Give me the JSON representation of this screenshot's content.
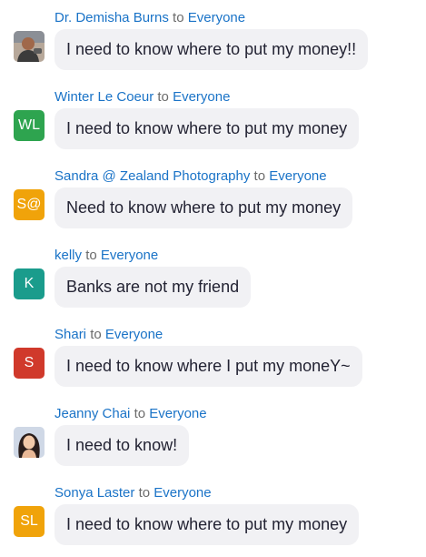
{
  "messages": [
    {
      "sender": "Dr. Demisha Burns",
      "to_word": "to",
      "recipient": "Everyone",
      "text": "I need to know where to put my money!!",
      "avatar_type": "photo",
      "avatar_initials": ""
    },
    {
      "sender": "Winter Le Coeur",
      "to_word": "to",
      "recipient": "Everyone",
      "text": "I need to know where to put my money",
      "avatar_type": "initials",
      "avatar_initials": "WL",
      "avatar_color": "#2ea44f"
    },
    {
      "sender": "Sandra @ Zealand Photography",
      "to_word": "to",
      "recipient": "Everyone",
      "text": "Need to know where to put my money",
      "avatar_type": "initials",
      "avatar_initials": "S@",
      "avatar_color": "#f0a30a"
    },
    {
      "sender": "kelly",
      "to_word": "to",
      "recipient": "Everyone",
      "text": "Banks are not my friend",
      "avatar_type": "initials",
      "avatar_initials": "K",
      "avatar_color": "#1a9c8c"
    },
    {
      "sender": "Shari",
      "to_word": "to",
      "recipient": "Everyone",
      "text": "I need to know where I put my moneY~",
      "avatar_type": "initials",
      "avatar_initials": "S",
      "avatar_color": "#d0392b"
    },
    {
      "sender": "Jeanny Chai",
      "to_word": "to",
      "recipient": "Everyone",
      "text": "I need to know!",
      "avatar_type": "photo",
      "avatar_initials": ""
    },
    {
      "sender": "Sonya Laster",
      "to_word": "to",
      "recipient": "Everyone",
      "text": "I need to know where to put my money",
      "avatar_type": "initials",
      "avatar_initials": "SL",
      "avatar_color": "#f0a30a"
    }
  ],
  "colors": {
    "sender": "#1a73c7",
    "to_word": "#6b6b6b",
    "bubble_bg": "#f1f1f4",
    "bubble_text": "#232333"
  }
}
